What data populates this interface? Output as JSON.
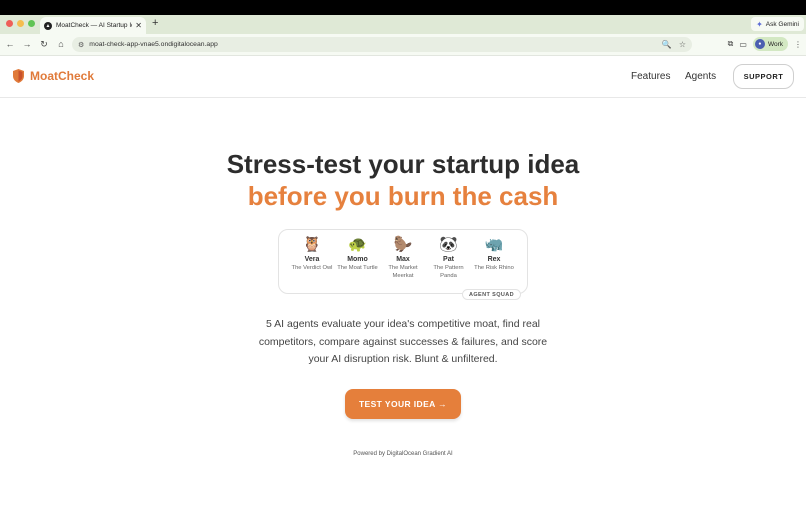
{
  "browser": {
    "tab_title": "MoatCheck — AI Startup Idea",
    "url": "moat-check-app-vnae5.ondigitalocean.app",
    "gemini_label": "Ask Gemini",
    "profile_label": "Work",
    "new_tab_glyph": "+",
    "close_glyph": "✕"
  },
  "header": {
    "brand": "MoatCheck",
    "nav": {
      "features": "Features",
      "agents": "Agents"
    },
    "support_label": "SUPPORT"
  },
  "hero": {
    "title": "Stress-test your startup idea",
    "subtitle": "before you burn the cash"
  },
  "squad": {
    "badge": "AGENT SQUAD",
    "agents": [
      {
        "emoji": "🦉",
        "name": "Vera",
        "role": "The Verdict Owl"
      },
      {
        "emoji": "🐢",
        "name": "Momo",
        "role": "The Moat Turtle"
      },
      {
        "emoji": "🦫",
        "name": "Max",
        "role": "The Market Meerkat"
      },
      {
        "emoji": "🐼",
        "name": "Pat",
        "role": "The Pattern Panda"
      },
      {
        "emoji": "🦏",
        "name": "Rex",
        "role": "The Risk Rhino"
      }
    ]
  },
  "description": "5 AI agents evaluate your idea's competitive moat, find real competitors, compare against successes & failures, and score your AI disruption risk. Blunt & unfiltered.",
  "cta_label": "TEST YOUR IDEA →",
  "footer_note": "Powered by DigitalOcean Gradient AI",
  "colors": {
    "accent": "#e57f3b",
    "heading": "#2d2d2d",
    "chrome": "#dfe9d6"
  }
}
